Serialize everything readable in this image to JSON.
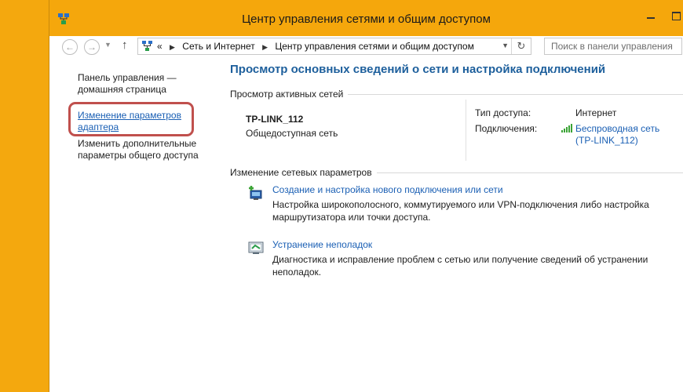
{
  "window": {
    "title": "Центр управления сетями и общим доступом"
  },
  "address": {
    "overflow": "«",
    "crumbs": [
      "Сеть и Интернет",
      "Центр управления сетями и общим доступом"
    ],
    "search_placeholder": "Поиск в панели управления"
  },
  "sidebar": {
    "home_link": "Панель управления — домашняя страница",
    "adapter_link": "Изменение параметров адаптера",
    "sharing_link": "Изменить дополнительные параметры общего доступа"
  },
  "main": {
    "title": "Просмотр основных сведений о сети и настройка подключений",
    "active_networks_header": "Просмотр активных сетей",
    "network": {
      "name": "TP-LINK_112",
      "category": "Общедоступная сеть",
      "access_type_label": "Тип доступа:",
      "access_type_value": "Интернет",
      "connections_label": "Подключения:",
      "connection_value": "Беспроводная сеть (TP-LINK_112)"
    },
    "change_settings_header": "Изменение сетевых параметров",
    "tasks": [
      {
        "link": "Создание и настройка нового подключения или сети",
        "desc": "Настройка широкополосного, коммутируемого или VPN-подключения либо настройка маршрутизатора или точки доступа."
      },
      {
        "link": "Устранение неполадок",
        "desc": "Диагностика и исправление проблем с сетью или получение сведений об устранении неполадок."
      }
    ]
  },
  "colors": {
    "titlebar": "#f5a70c",
    "link": "#1a5fb4",
    "heading": "#1d5f9c",
    "highlight": "#c0504d"
  }
}
